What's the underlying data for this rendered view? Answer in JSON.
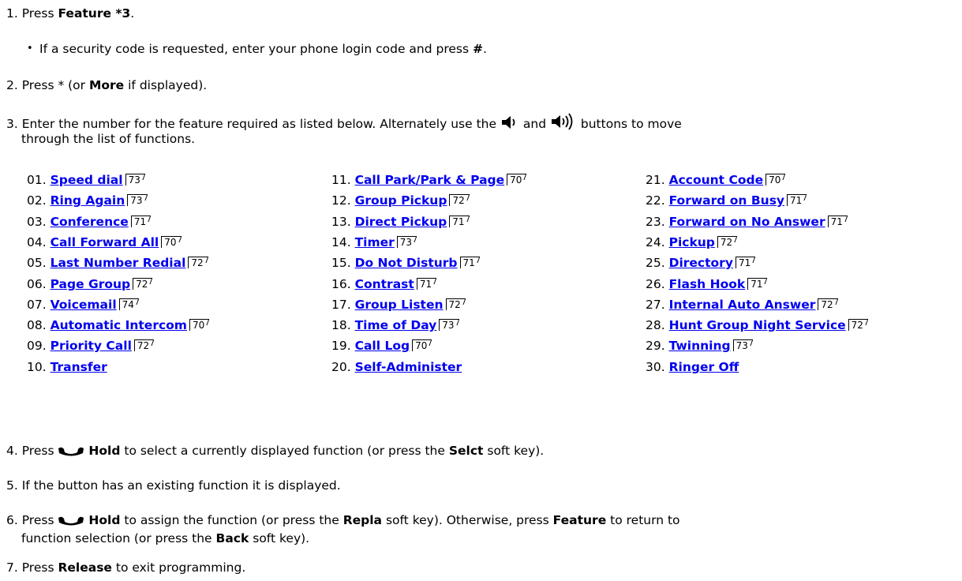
{
  "steps": [
    {
      "num": "1.",
      "pre": "Press ",
      "bold": "Feature *3",
      "post": "."
    },
    {
      "bullet_pre": "If a security code is requested, enter your phone login code and press ",
      "bullet_bold": "#",
      "bullet_post": "."
    },
    {
      "num": "2.",
      "pre": "Press * (or ",
      "bold": "More",
      "post": " if displayed)."
    },
    {
      "num": "3.",
      "pre": "Enter the number for the feature required as listed below. Alternately use the ",
      "mid": " and ",
      "post": " buttons to move",
      "line2": "through the list of functions."
    },
    {
      "num": "4.",
      "pre": "Press ",
      "bold": "Hold",
      "mid": " to select a currently displayed function (or press the ",
      "bold2": "Selct",
      "post": " soft key)."
    },
    {
      "num": "5.",
      "text": " If the button has an existing function it is displayed."
    },
    {
      "num": "6.",
      "pre": "Press ",
      "bold": "Hold",
      "mid": " to assign the function (or press the ",
      "bold2": "Repla",
      "mid2": " soft key). Otherwise, press ",
      "bold3": "Feature",
      "post": " to return to",
      "line2_pre": "function selection (or press the ",
      "line2_bold": "Back",
      "line2_post": " soft key)."
    },
    {
      "num": "7.",
      "pre": "Press ",
      "bold": "Release",
      "post": " to exit programming."
    }
  ],
  "icons": [
    "volume-down-icon",
    "volume-up-icon",
    "hold-handset-icon"
  ],
  "features": [
    {
      "n": "01.",
      "label": "Speed dial",
      "ref": "73"
    },
    {
      "n": "02.",
      "label": "Ring Again",
      "ref": "73"
    },
    {
      "n": "03.",
      "label": "Conference",
      "ref": "71"
    },
    {
      "n": "04.",
      "label": "Call Forward All",
      "ref": "70"
    },
    {
      "n": "05.",
      "label": "Last Number Redial",
      "ref": "72"
    },
    {
      "n": "06.",
      "label": "Page Group",
      "ref": "72"
    },
    {
      "n": "07.",
      "label": "Voicemail",
      "ref": "74"
    },
    {
      "n": "08.",
      "label": "Automatic Intercom",
      "ref": "70"
    },
    {
      "n": "09.",
      "label": "Priority Call",
      "ref": "72"
    },
    {
      "n": "10.",
      "label": "Transfer",
      "ref": ""
    },
    {
      "n": "11.",
      "label": "Call Park/Park & Page",
      "ref": "70"
    },
    {
      "n": "12.",
      "label": "Group Pickup",
      "ref": "72"
    },
    {
      "n": "13.",
      "label": "Direct Pickup",
      "ref": "71"
    },
    {
      "n": "14.",
      "label": "Timer",
      "ref": "73"
    },
    {
      "n": "15.",
      "label": "Do Not Disturb",
      "ref": "71"
    },
    {
      "n": "16.",
      "label": "Contrast",
      "ref": "71"
    },
    {
      "n": "17.",
      "label": "Group Listen",
      "ref": "72"
    },
    {
      "n": "18.",
      "label": "Time of Day",
      "ref": "73"
    },
    {
      "n": "19.",
      "label": "Call Log",
      "ref": "70"
    },
    {
      "n": "20.",
      "label": "Self-Administer",
      "ref": ""
    },
    {
      "n": "21.",
      "label": "Account Code",
      "ref": "70"
    },
    {
      "n": "22.",
      "label": "Forward on Busy",
      "ref": "71"
    },
    {
      "n": "23.",
      "label": "Forward on No Answer",
      "ref": "71"
    },
    {
      "n": "24.",
      "label": "Pickup",
      "ref": "72"
    },
    {
      "n": "25.",
      "label": "Directory",
      "ref": "71"
    },
    {
      "n": "26.",
      "label": "Flash Hook",
      "ref": "71"
    },
    {
      "n": "27.",
      "label": "Internal Auto Answer",
      "ref": "72"
    },
    {
      "n": "28.",
      "label": "Hunt Group Night Service",
      "ref": "72"
    },
    {
      "n": "29.",
      "label": "Twinning",
      "ref": "73"
    },
    {
      "n": "30.",
      "label": "Ringer Off",
      "ref": ""
    }
  ]
}
